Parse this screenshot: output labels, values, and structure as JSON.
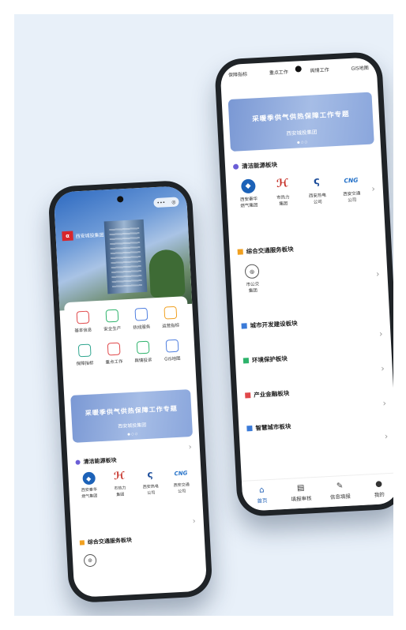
{
  "phone_left": {
    "capsule": {
      "menu": "•••",
      "close": "◎"
    },
    "logo_text": "西安城投集团",
    "quick_grid": [
      {
        "label": "基本信息",
        "icon": "document-icon",
        "color": "#e0484a"
      },
      {
        "label": "安全生产",
        "icon": "stack-icon",
        "color": "#2db36b"
      },
      {
        "label": "热线服务",
        "icon": "phone-icon",
        "color": "#4f7fe0"
      },
      {
        "label": "运营指标",
        "icon": "monitor-icon",
        "color": "#f0a020"
      },
      {
        "label": "保障指标",
        "icon": "shield-icon",
        "color": "#2fa58f"
      },
      {
        "label": "重点工作",
        "icon": "calendar-icon",
        "color": "#e0484a"
      },
      {
        "label": "舆情投诉",
        "icon": "screen-icon",
        "color": "#2db36b"
      },
      {
        "label": "GIS地图",
        "icon": "map-pin-icon",
        "color": "#4f7fe0"
      }
    ],
    "banner": {
      "title": "采暖季供气供热保障工作专题",
      "subtitle": "西安城投集团"
    },
    "clean_energy": {
      "title": "清洁能源板块",
      "companies": [
        "西安秦华\n燃气集团",
        "市热力\n集团",
        "西安热电\n公司",
        "西安交通\n公司"
      ]
    },
    "transport": {
      "title": "综合交通服务板块"
    }
  },
  "phone_right": {
    "top_nav": [
      "保障指标",
      "重点工作",
      "舆情工作",
      "GIS地图"
    ],
    "banner": {
      "title": "采暖季供气供热保障工作专题",
      "subtitle": "西安城投集团"
    },
    "clean_energy": {
      "title": "清洁能源板块",
      "companies": [
        "西安秦华\n燃气集团",
        "市热力\n集团",
        "西安热电\n公司",
        "西安交通\n公司"
      ]
    },
    "transport": {
      "title": "综合交通服务板块",
      "companies": [
        "市公交\n集团"
      ]
    },
    "sections": [
      {
        "title": "城市开发建设板块",
        "color": "#3a7ad8"
      },
      {
        "title": "环境保护板块",
        "color": "#2db36b"
      },
      {
        "title": "产业金融板块",
        "color": "#e0484a"
      },
      {
        "title": "智慧城市板块",
        "color": "#3a7ad8"
      }
    ],
    "tabs": [
      {
        "label": "首页",
        "icon": "home-icon"
      },
      {
        "label": "填报审核",
        "icon": "form-icon"
      },
      {
        "label": "信息填报",
        "icon": "edit-icon"
      },
      {
        "label": "我的",
        "icon": "user-icon"
      }
    ]
  }
}
